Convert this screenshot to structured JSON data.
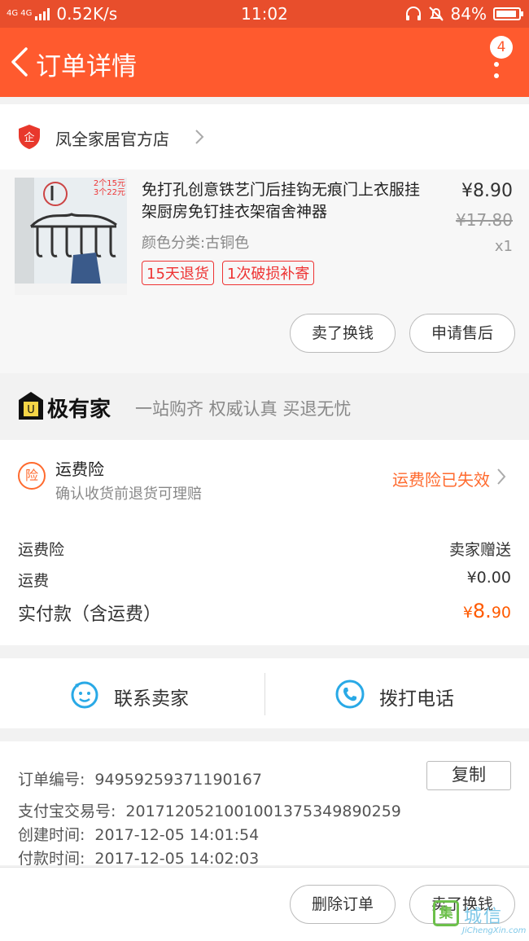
{
  "status_bar": {
    "network_type": "4G 4G",
    "speed": "0.52K/s",
    "time": "11:02",
    "battery": "84%"
  },
  "nav": {
    "title": "订单详情",
    "badge_count": "4"
  },
  "shop": {
    "name": "凤全家居官方店"
  },
  "item": {
    "title": "免打孔创意铁艺门后挂钩无痕门上衣服挂架厨房免钉挂衣架宿舍神器",
    "sku": "颜色分类:古铜色",
    "tags": [
      "15天退货",
      "1次破损补寄"
    ],
    "price": "¥8.90",
    "original_price": "¥17.80",
    "quantity": "x1",
    "image_promo": [
      "2个15元",
      "3个22元"
    ],
    "buttons": [
      "卖了换钱",
      "申请售后"
    ]
  },
  "jiyoujia": {
    "brand": "极有家",
    "slogan": "一站购齐 权威认真 买退无忧"
  },
  "insurance": {
    "icon_text": "险",
    "title": "运费险",
    "subtitle": "确认收货前退货可理赔",
    "status": "运费险已失效"
  },
  "summary": {
    "rows": [
      {
        "label": "运费险",
        "value": "卖家赠送"
      },
      {
        "label": "运费",
        "value": "¥0.00"
      }
    ],
    "total_label": "实付款（含运费）",
    "total_currency": "¥",
    "total_int": "8.",
    "total_dec": "90"
  },
  "contact": {
    "seller_label": "联系卖家",
    "call_label": "拨打电话"
  },
  "order_info": {
    "order_no_label": "订单编号:",
    "order_no": "94959259371190167",
    "copy_label": "复制",
    "alipay_label": "支付宝交易号:",
    "alipay_no": "2017120521001001375349890259",
    "created_label": "创建时间:",
    "created": "2017-12-05 14:01:54",
    "paid_label": "付款时间:",
    "paid": "2017-12-05 14:02:03"
  },
  "bottom_bar": {
    "delete_label": "删除订单",
    "sell_label": "卖了换钱"
  },
  "watermark": {
    "mark": "集",
    "text": "城信",
    "sub": "JiChengXin.com"
  },
  "colors": {
    "nav_bg": "#ff5a2e",
    "status_bg": "#e84e2c",
    "accent_orange": "#ff6a2e",
    "tag_red": "#e33333",
    "contact_blue": "#29a9e6"
  }
}
